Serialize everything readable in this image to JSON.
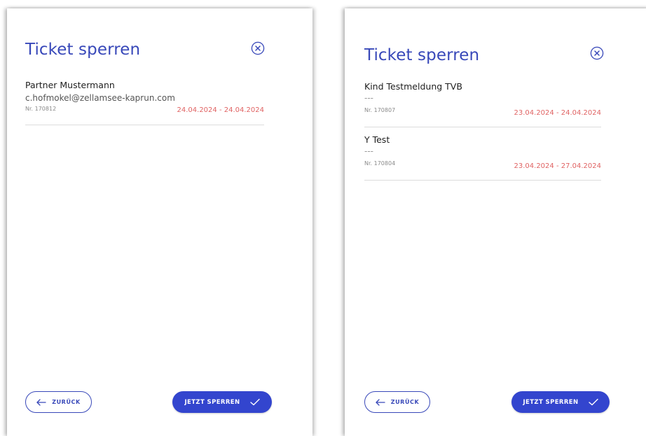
{
  "colors": {
    "accent": "#3848b9",
    "primary_button": "#3345ce",
    "date_text": "#e06363"
  },
  "left_panel": {
    "title": "Ticket sperren",
    "tickets": [
      {
        "name": "Partner Mustermann",
        "subtitle": "c.hofmokel@zellamsee-kaprun.com",
        "nr": "Nr. 170812",
        "date_range": "24.04.2024 - 24.04.2024"
      }
    ],
    "back_label": "ZURÜCK",
    "confirm_label": "JETZT SPERREN"
  },
  "right_panel": {
    "title": "Ticket sperren",
    "tickets": [
      {
        "name": "Kind Testmeldung TVB",
        "subtitle": "---",
        "nr": "Nr. 170807",
        "date_range": "23.04.2024 - 24.04.2024"
      },
      {
        "name": "Y Test",
        "subtitle": "---",
        "nr": "Nr. 170804",
        "date_range": "23.04.2024 - 27.04.2024"
      }
    ],
    "back_label": "ZURÜCK",
    "confirm_label": "JETZT SPERREN"
  },
  "icons": {
    "close": "close-circle-icon",
    "back": "arrow-left-icon",
    "confirm": "checkmark-icon"
  }
}
